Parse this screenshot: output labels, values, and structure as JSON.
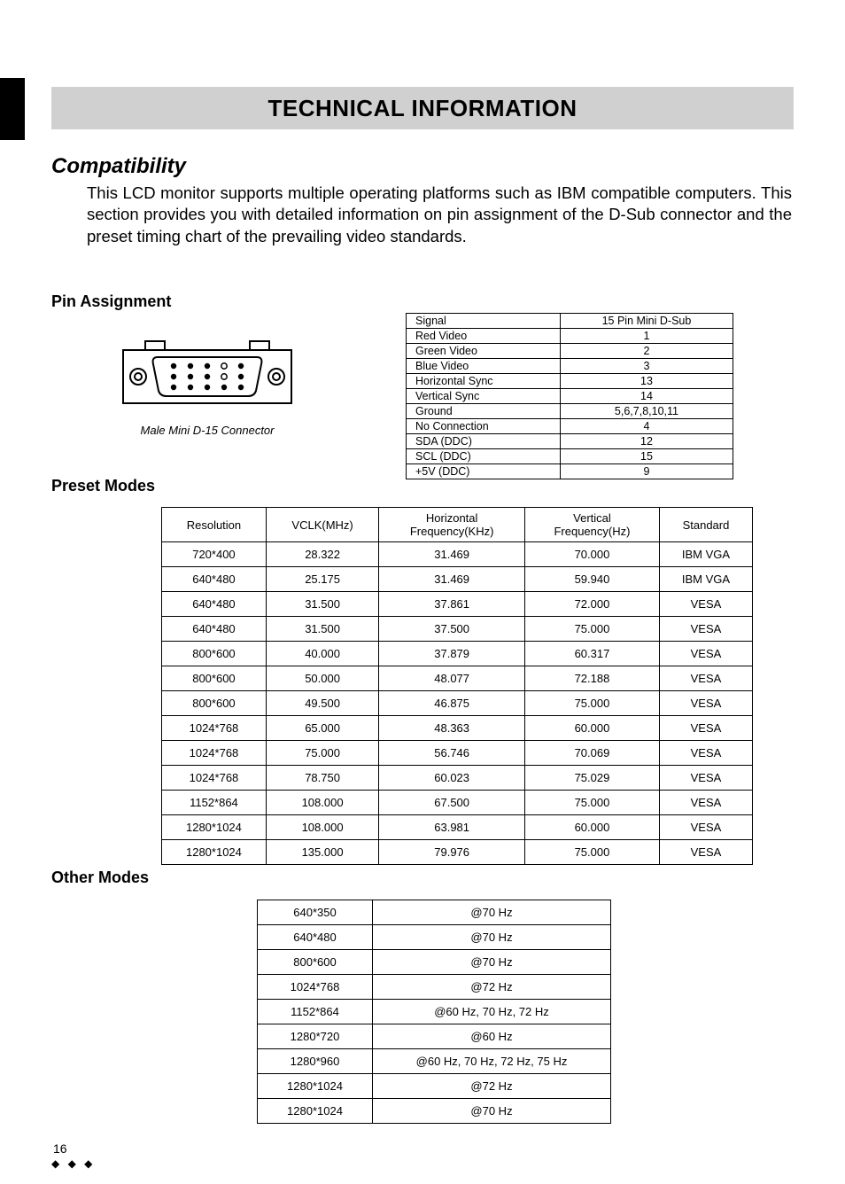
{
  "title": "TECHNICAL INFORMATION",
  "compatibility": {
    "heading": "Compatibility",
    "body": "This LCD monitor supports multiple operating platforms such as IBM compatible computers. This section provides you with detailed information on pin assignment of the D-Sub connector and the preset timing chart of the prevailing video standards."
  },
  "pin_assignment": {
    "heading": "Pin Assignment",
    "caption": "Male Mini D-15 Connector",
    "header": {
      "signal": "Signal",
      "pin": "15 Pin Mini D-Sub"
    },
    "rows": [
      {
        "signal": "Red Video",
        "pin": "1"
      },
      {
        "signal": "Green Video",
        "pin": "2"
      },
      {
        "signal": "Blue Video",
        "pin": "3"
      },
      {
        "signal": "Horizontal Sync",
        "pin": "13"
      },
      {
        "signal": "Vertical Sync",
        "pin": "14"
      },
      {
        "signal": "Ground",
        "pin": "5,6,7,8,10,11"
      },
      {
        "signal": "No Connection",
        "pin": "4"
      },
      {
        "signal": "SDA (DDC)",
        "pin": "12"
      },
      {
        "signal": "SCL (DDC)",
        "pin": "15"
      },
      {
        "signal": "+5V (DDC)",
        "pin": "9"
      }
    ]
  },
  "preset_modes": {
    "heading": "Preset Modes",
    "header": {
      "res": "Resolution",
      "vclk": "VCLK(MHz)",
      "hfreq_l1": "Horizontal",
      "hfreq_l2": "Frequency(KHz)",
      "vfreq_l1": "Vertical",
      "vfreq_l2": "Frequency(Hz)",
      "std": "Standard"
    },
    "rows": [
      [
        "720*400",
        "28.322",
        "31.469",
        "70.000",
        "IBM VGA"
      ],
      [
        "640*480",
        "25.175",
        "31.469",
        "59.940",
        "IBM VGA"
      ],
      [
        "640*480",
        "31.500",
        "37.861",
        "72.000",
        "VESA"
      ],
      [
        "640*480",
        "31.500",
        "37.500",
        "75.000",
        "VESA"
      ],
      [
        "800*600",
        "40.000",
        "37.879",
        "60.317",
        "VESA"
      ],
      [
        "800*600",
        "50.000",
        "48.077",
        "72.188",
        "VESA"
      ],
      [
        "800*600",
        "49.500",
        "46.875",
        "75.000",
        "VESA"
      ],
      [
        "1024*768",
        "65.000",
        "48.363",
        "60.000",
        "VESA"
      ],
      [
        "1024*768",
        "75.000",
        "56.746",
        "70.069",
        "VESA"
      ],
      [
        "1024*768",
        "78.750",
        "60.023",
        "75.029",
        "VESA"
      ],
      [
        "1152*864",
        "108.000",
        "67.500",
        "75.000",
        "VESA"
      ],
      [
        "1280*1024",
        "108.000",
        "63.981",
        "60.000",
        "VESA"
      ],
      [
        "1280*1024",
        "135.000",
        "79.976",
        "75.000",
        "VESA"
      ]
    ]
  },
  "other_modes": {
    "heading": "Other Modes",
    "rows": [
      [
        "640*350",
        "@70 Hz"
      ],
      [
        "640*480",
        "@70 Hz"
      ],
      [
        "800*600",
        "@70 Hz"
      ],
      [
        "1024*768",
        "@72 Hz"
      ],
      [
        "1152*864",
        "@60 Hz, 70 Hz, 72 Hz"
      ],
      [
        "1280*720",
        "@60 Hz"
      ],
      [
        "1280*960",
        "@60 Hz, 70 Hz, 72 Hz, 75 Hz"
      ],
      [
        "1280*1024",
        "@72 Hz"
      ],
      [
        "1280*1024",
        "@70 Hz"
      ]
    ]
  },
  "page_number": "16",
  "diamonds": "◆ ◆ ◆"
}
